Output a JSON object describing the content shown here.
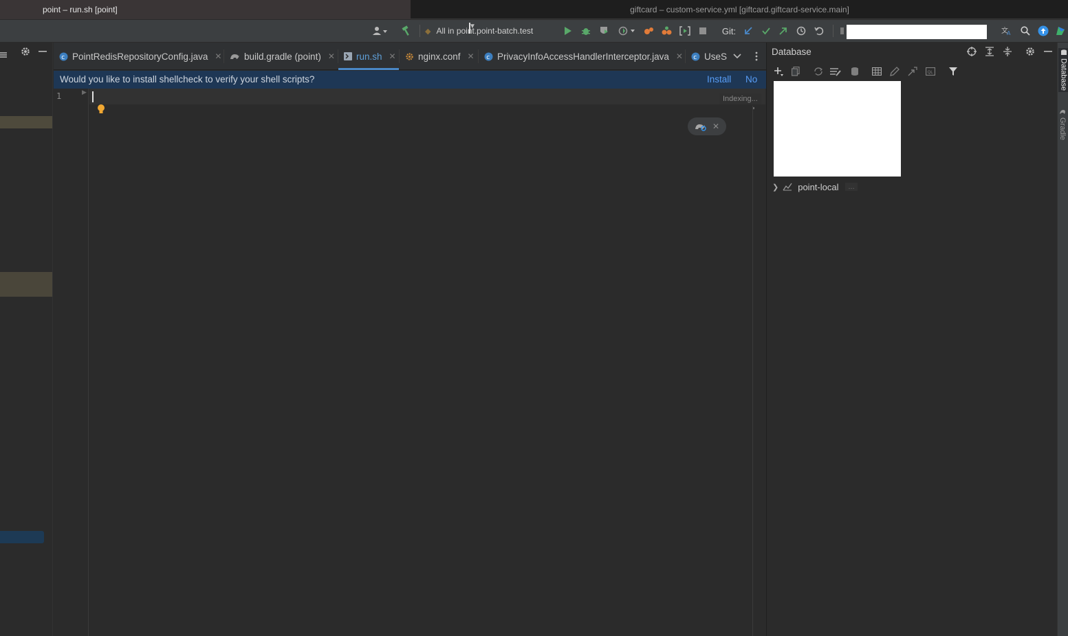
{
  "window_tabs": {
    "active": "point – run.sh [point]",
    "inactive": "giftcard – custom-service.yml [giftcard.giftcard-service.main]"
  },
  "toolbar": {
    "run_config": "All in point.point-batch.test",
    "git_label": "Git:"
  },
  "editor_tabs": [
    {
      "label": "PointRedisRepositoryConfig.java",
      "icon": "java-class-icon"
    },
    {
      "label": "build.gradle (point)",
      "icon": "gradle-icon"
    },
    {
      "label": "run.sh",
      "icon": "shell-script-icon",
      "active": true
    },
    {
      "label": "nginx.conf",
      "icon": "config-file-icon"
    },
    {
      "label": "PrivacyInfoAccessHandlerInterceptor.java",
      "icon": "java-class-icon"
    },
    {
      "label": "UseS",
      "icon": "java-class-icon"
    }
  ],
  "notification": {
    "message": "Would you like to install shellcheck to verify your shell scripts?",
    "install": "Install",
    "no": "No"
  },
  "editor": {
    "line_numbers": [
      "1"
    ],
    "status": "Indexing..."
  },
  "database": {
    "title": "Database",
    "tree": [
      {
        "label": "point-local",
        "extra": "..."
      }
    ]
  },
  "right_stripe": {
    "database": "Database",
    "gradle": "Gradle"
  },
  "colors": {
    "accent": "#4a88c7",
    "notification_bg": "#1e3755",
    "link": "#589df6",
    "run_green": "#59a869",
    "debug_orange": "#e07b39"
  }
}
